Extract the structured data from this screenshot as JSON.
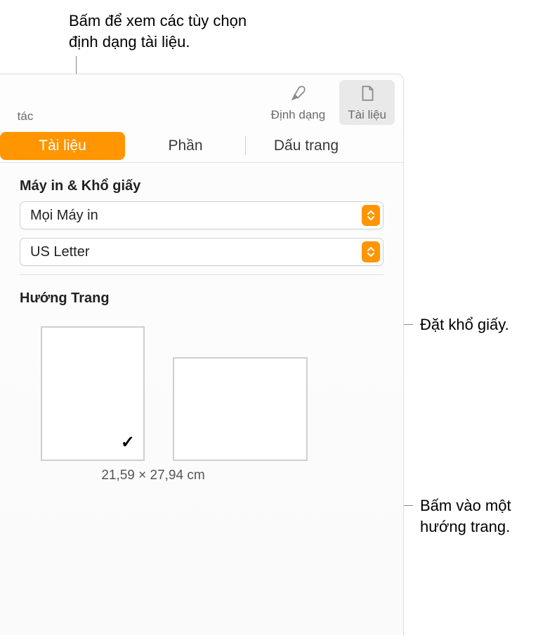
{
  "callouts": {
    "top": "Bấm để xem các tùy chọn định dạng tài liệu.",
    "paper": "Đặt khổ giấy.",
    "orientation": "Bấm vào một hướng trang."
  },
  "toolbar": {
    "left_partial": "tác",
    "format_label": "Định dạng",
    "document_label": "Tài liệu"
  },
  "tabs": {
    "document": "Tài liệu",
    "section": "Phần",
    "bookmarks": "Dấu trang"
  },
  "printer_paper": {
    "title": "Máy in & Khổ giấy",
    "printer_value": "Mọi Máy in",
    "paper_value": "US Letter"
  },
  "orientation": {
    "title": "Hướng Trang",
    "dimensions": "21,59 × 27,94 cm"
  }
}
